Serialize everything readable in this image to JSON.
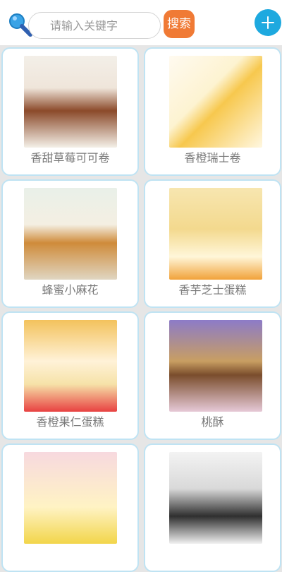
{
  "header": {
    "search_placeholder": "请输入关键字",
    "search_button": "搜索",
    "add_button": "+"
  },
  "recipes": [
    {
      "title": "香甜草莓可可卷"
    },
    {
      "title": "香橙瑞士卷"
    },
    {
      "title": "蜂蜜小麻花"
    },
    {
      "title": "香芋芝士蛋糕"
    },
    {
      "title": "香橙果仁蛋糕"
    },
    {
      "title": "桃酥"
    },
    {
      "title": ""
    },
    {
      "title": ""
    }
  ]
}
